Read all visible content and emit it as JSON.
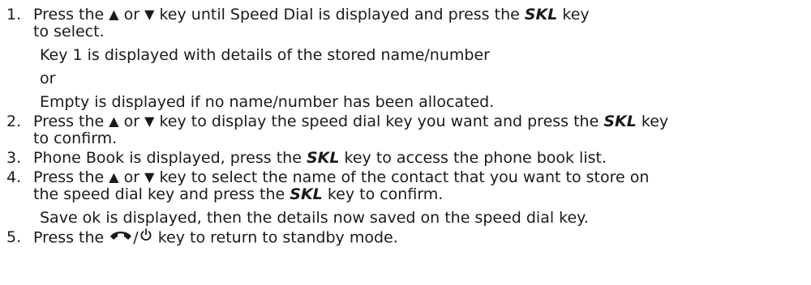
{
  "symbols": {
    "up": "▲",
    "down": "▼",
    "slash": "/"
  },
  "icons": {
    "up_arrow": "up-triangle-icon",
    "down_arrow": "down-triangle-icon",
    "end_call": "end-call-icon",
    "power": "power-icon"
  },
  "steps": [
    {
      "number": "1.",
      "a": "Press the",
      "or": "or",
      "b": "key until Speed Dial is displayed and press the",
      "skl": "SKL",
      "c": "key",
      "c2": "to select."
    },
    {
      "number": "2.",
      "a": "Press the",
      "or": "or",
      "b": "key to display the speed dial key you want and press the",
      "skl": "SKL",
      "c": "key",
      "c2": "to confirm."
    },
    {
      "number": "3.",
      "a": "Phone Book is displayed, press the",
      "skl": "SKL",
      "b": "key to access the phone book list."
    },
    {
      "number": "4.",
      "a": "Press the",
      "or": "or",
      "b": "key to select the name of the contact that you want to store on",
      "c2": "the speed dial key and press the",
      "skl": "SKL",
      "c": "key to confirm."
    },
    {
      "number": "5.",
      "a": "Press the",
      "b": "key to return to standby mode."
    }
  ],
  "sub": {
    "key1": "Key 1 is displayed with details of the stored name/number",
    "or": "or",
    "empty": "Empty is displayed if no name/number has been allocated.",
    "saveok": "Save ok is displayed, then the details now saved on the speed dial key."
  }
}
